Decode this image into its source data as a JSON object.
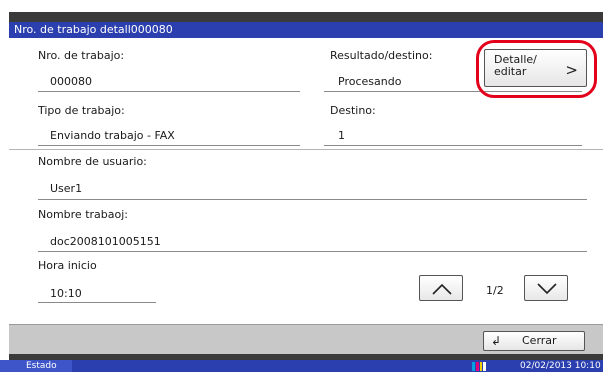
{
  "header": {
    "title": "Nro. de trabajo detall000080"
  },
  "fields": {
    "job_number": {
      "label": "Nro. de trabajo:",
      "value": "000080"
    },
    "result": {
      "label": "Resultado/destino:",
      "value": "Procesando"
    },
    "job_type": {
      "label": "Tipo de trabajo:",
      "value": "Enviando trabajo - FAX"
    },
    "destination": {
      "label": "Destino:",
      "value": "1"
    },
    "user_name": {
      "label": "Nombre de usuario:",
      "value": "User1"
    },
    "job_name": {
      "label": "Nombre trabaoj:",
      "value": "doc2008101005151"
    },
    "start_time": {
      "label": "Hora inicio",
      "value": "10:10"
    }
  },
  "detail_button": {
    "line1": "Detalle/",
    "line2": "editar"
  },
  "pager": {
    "indicator": "1/2"
  },
  "close_button": {
    "label": "Cerrar"
  },
  "statusbar": {
    "status_label": "Estado",
    "datetime": "02/02/2013  10:10"
  },
  "colors": {
    "title_blue": "#2b3fae",
    "highlight_red": "#e3001b",
    "toner": [
      "#00a0e0",
      "#e0007a",
      "#f0d000",
      "#1a1a1a"
    ]
  }
}
